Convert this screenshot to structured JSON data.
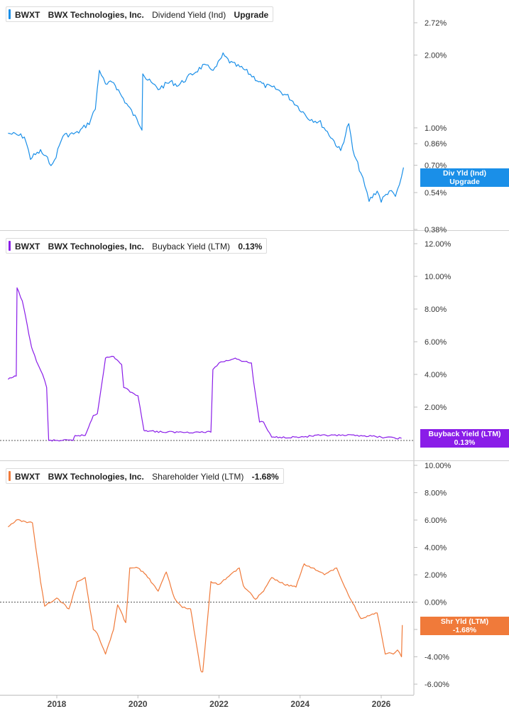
{
  "x_axis_ticks": [
    "2018",
    "2020",
    "2022",
    "2024",
    "2026"
  ],
  "chart_data": [
    {
      "type": "line",
      "ticker": "BWXT",
      "company": "BWX Technologies, Inc.",
      "metric": "Dividend Yield (Ind)",
      "value_label": "Upgrade",
      "badge": {
        "line1": "Div Yld (Ind)",
        "line2": "Upgrade"
      },
      "color": "#1a8fe8",
      "scale": "log",
      "y_ticks": [
        "2.72%",
        "2.00%",
        "1.00%",
        "0.86%",
        "0.70%",
        "0.54%",
        "0.38%"
      ],
      "y_tick_values": [
        2.72,
        2.0,
        1.0,
        0.86,
        0.7,
        0.54,
        0.38
      ],
      "series": [
        {
          "x": [
            2016.8,
            2017.2,
            2017.35,
            2017.6,
            2017.9,
            2018.15,
            2018.5,
            2018.8,
            2018.95,
            2019.05,
            2019.2,
            2019.4,
            2019.6,
            2019.8,
            2020.1,
            2020.12,
            2020.2,
            2020.5,
            2020.8,
            2021.0,
            2021.3,
            2021.6,
            2021.9,
            2022.1,
            2022.3,
            2022.6,
            2022.9,
            2023.1,
            2023.4,
            2023.7,
            2023.9,
            2024.2,
            2024.5,
            2024.8,
            2025.0,
            2025.2,
            2025.3,
            2025.5,
            2025.6,
            2025.7,
            2025.9,
            2026.0,
            2026.2,
            2026.35,
            2026.45,
            2026.55
          ],
          "y": [
            0.95,
            0.92,
            0.75,
            0.8,
            0.7,
            0.93,
            0.95,
            1.05,
            1.2,
            1.75,
            1.5,
            1.55,
            1.35,
            1.2,
            1.0,
            1.7,
            1.6,
            1.45,
            1.55,
            1.5,
            1.65,
            1.8,
            1.75,
            2.0,
            1.85,
            1.75,
            1.6,
            1.5,
            1.45,
            1.35,
            1.25,
            1.1,
            1.05,
            0.9,
            0.8,
            1.05,
            0.8,
            0.65,
            0.57,
            0.5,
            0.55,
            0.5,
            0.55,
            0.52,
            0.58,
            0.68
          ]
        }
      ]
    },
    {
      "type": "line",
      "ticker": "BWXT",
      "company": "BWX Technologies, Inc.",
      "metric": "Buyback Yield (LTM)",
      "value_label": "0.13%",
      "badge": {
        "line1": "Buyback Yield (LTM)",
        "line2": "0.13%"
      },
      "color": "#8a1de8",
      "y_ticks": [
        "12.00%",
        "10.00%",
        "8.00%",
        "6.00%",
        "4.00%",
        "2.00%"
      ],
      "y_tick_values": [
        12,
        10,
        8,
        6,
        4,
        2
      ],
      "series": [
        {
          "x": [
            2016.8,
            2017.0,
            2017.02,
            2017.15,
            2017.35,
            2017.4,
            2017.5,
            2017.65,
            2017.75,
            2017.8,
            2018.4,
            2018.45,
            2018.7,
            2018.9,
            2019.0,
            2019.2,
            2019.4,
            2019.6,
            2019.65,
            2019.85,
            2020.0,
            2020.15,
            2020.2,
            2020.6,
            2021.0,
            2021.4,
            2021.8,
            2021.85,
            2022.0,
            2022.4,
            2022.6,
            2022.8,
            2022.85,
            2023.0,
            2023.1,
            2023.2,
            2023.3,
            2023.5,
            2024.0,
            2024.5,
            2025.0,
            2025.5,
            2026.0,
            2026.5
          ],
          "y": [
            3.7,
            3.9,
            9.3,
            8.5,
            6.0,
            5.5,
            4.8,
            4.0,
            3.2,
            0.0,
            0.0,
            0.3,
            0.3,
            1.5,
            1.6,
            5.0,
            5.1,
            4.6,
            3.2,
            2.9,
            2.7,
            0.6,
            0.6,
            0.5,
            0.5,
            0.5,
            0.5,
            4.3,
            4.7,
            5.0,
            4.8,
            4.7,
            3.6,
            1.1,
            1.1,
            0.6,
            0.2,
            0.2,
            0.2,
            0.3,
            0.3,
            0.3,
            0.2,
            0.13
          ]
        }
      ]
    },
    {
      "type": "line",
      "ticker": "BWXT",
      "company": "BWX Technologies, Inc.",
      "metric": "Shareholder Yield (LTM)",
      "value_label": "-1.68%",
      "badge": {
        "line1": "Shr Yld (LTM)",
        "line2": "-1.68%"
      },
      "color": "#f07a3a",
      "y_ticks": [
        "10.00%",
        "8.00%",
        "6.00%",
        "4.00%",
        "2.00%",
        "0.00%",
        "-2.00%",
        "-4.00%",
        "-6.00%"
      ],
      "y_tick_values": [
        10,
        8,
        6,
        4,
        2,
        0,
        -2,
        -4,
        -6
      ],
      "series": [
        {
          "x": [
            2016.8,
            2017.0,
            2017.4,
            2017.6,
            2017.7,
            2018.0,
            2018.3,
            2018.5,
            2018.7,
            2018.9,
            2019.0,
            2019.2,
            2019.4,
            2019.5,
            2019.7,
            2019.8,
            2020.0,
            2020.2,
            2020.5,
            2020.7,
            2020.9,
            2021.1,
            2021.3,
            2021.55,
            2021.6,
            2021.7,
            2021.8,
            2022.0,
            2022.2,
            2022.5,
            2022.6,
            2022.9,
            2023.1,
            2023.3,
            2023.6,
            2023.9,
            2024.1,
            2024.3,
            2024.6,
            2024.9,
            2025.1,
            2025.3,
            2025.5,
            2025.7,
            2025.9,
            2026.1,
            2026.2,
            2026.3,
            2026.4,
            2026.5,
            2026.52
          ],
          "y": [
            5.5,
            6.0,
            5.8,
            1.5,
            -0.3,
            0.3,
            -0.5,
            1.5,
            1.8,
            -2.0,
            -2.3,
            -3.8,
            -2.0,
            -0.2,
            -1.5,
            2.5,
            2.5,
            2.0,
            0.8,
            2.2,
            0.3,
            -0.4,
            -0.5,
            -5.0,
            -5.1,
            -1.8,
            1.5,
            1.3,
            1.8,
            2.5,
            1.2,
            0.2,
            0.8,
            1.8,
            1.3,
            1.1,
            2.8,
            2.5,
            2.0,
            2.5,
            1.1,
            -0.1,
            -1.2,
            -1.0,
            -0.8,
            -3.8,
            -3.7,
            -3.8,
            -3.5,
            -4.0,
            -1.68
          ]
        }
      ]
    }
  ]
}
